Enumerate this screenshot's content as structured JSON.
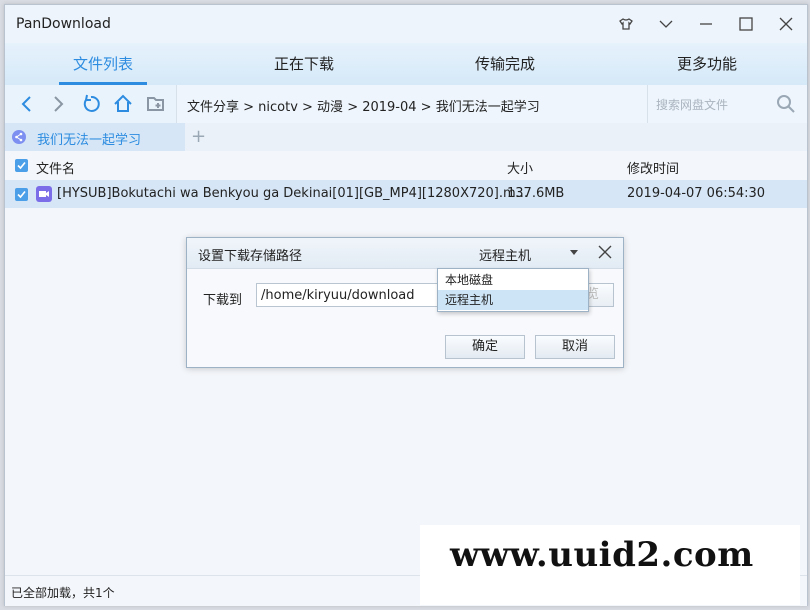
{
  "window": {
    "title": "PanDownload"
  },
  "tabs": [
    {
      "label": "文件列表"
    },
    {
      "label": "正在下载"
    },
    {
      "label": "传输完成"
    },
    {
      "label": "更多功能"
    }
  ],
  "toolbar": {
    "path": "文件分享 > nicotv > 动漫 > 2019-04 > 我们无法一起学习",
    "search_placeholder": "搜索网盘文件"
  },
  "folder_tab": {
    "label": "我们无法一起学习"
  },
  "file_list": {
    "columns": {
      "name": "文件名",
      "size": "大小",
      "modified": "修改时间"
    },
    "rows": [
      {
        "name": "[HYSUB]Bokutachi wa Benkyou ga Dekinai[01][GB_MP4][1280X720].m...",
        "size": "137.6MB",
        "modified": "2019-04-07 06:54:30"
      }
    ]
  },
  "status": {
    "text": "已全部加载，共1个"
  },
  "dialog": {
    "title": "设置下载存储路径",
    "storage_selected": "远程主机",
    "download_to_label": "下载到",
    "path_value": "/home/kiryuu/download",
    "browse_label": "览",
    "ok_label": "确定",
    "cancel_label": "取消",
    "dropdown_options": [
      "本地磁盘",
      "远程主机"
    ]
  },
  "watermark": {
    "text": "www.uuid2.com"
  },
  "colors": {
    "accent": "#2d8ce0",
    "selection": "#d6e6f6"
  }
}
